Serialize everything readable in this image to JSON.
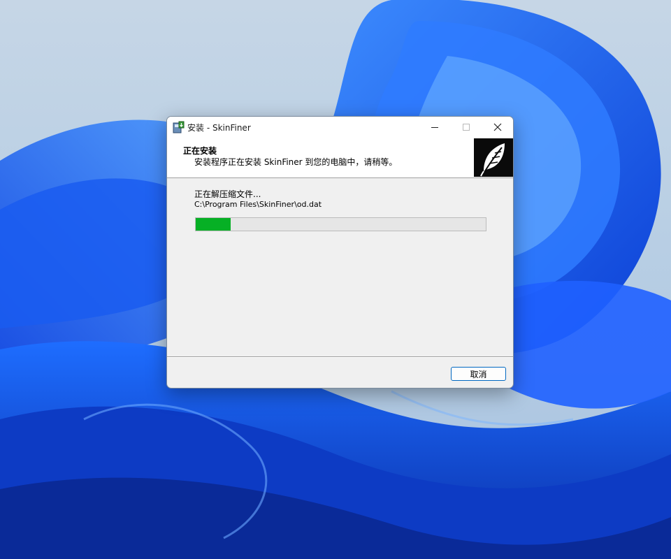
{
  "window": {
    "title": "安装 - SkinFiner"
  },
  "header": {
    "title": "正在安装",
    "subtitle": "安装程序正在安装 SkinFiner 到您的电脑中，请稍等。"
  },
  "status": {
    "label": "正在解压缩文件...",
    "file_path": "C:\\Program Files\\SkinFiner\\od.dat",
    "progress": 0.12
  },
  "buttons": {
    "cancel_label": "取消"
  },
  "colors": {
    "progress_fill": "#06b025",
    "button_border": "#0067c0",
    "logo_background": "#0a0a0a"
  },
  "icons": {
    "app": "installer-app-icon",
    "logo": "leaf-logo-icon",
    "minimize": "minimize-icon",
    "maximize": "maximize-icon",
    "close": "close-icon"
  }
}
